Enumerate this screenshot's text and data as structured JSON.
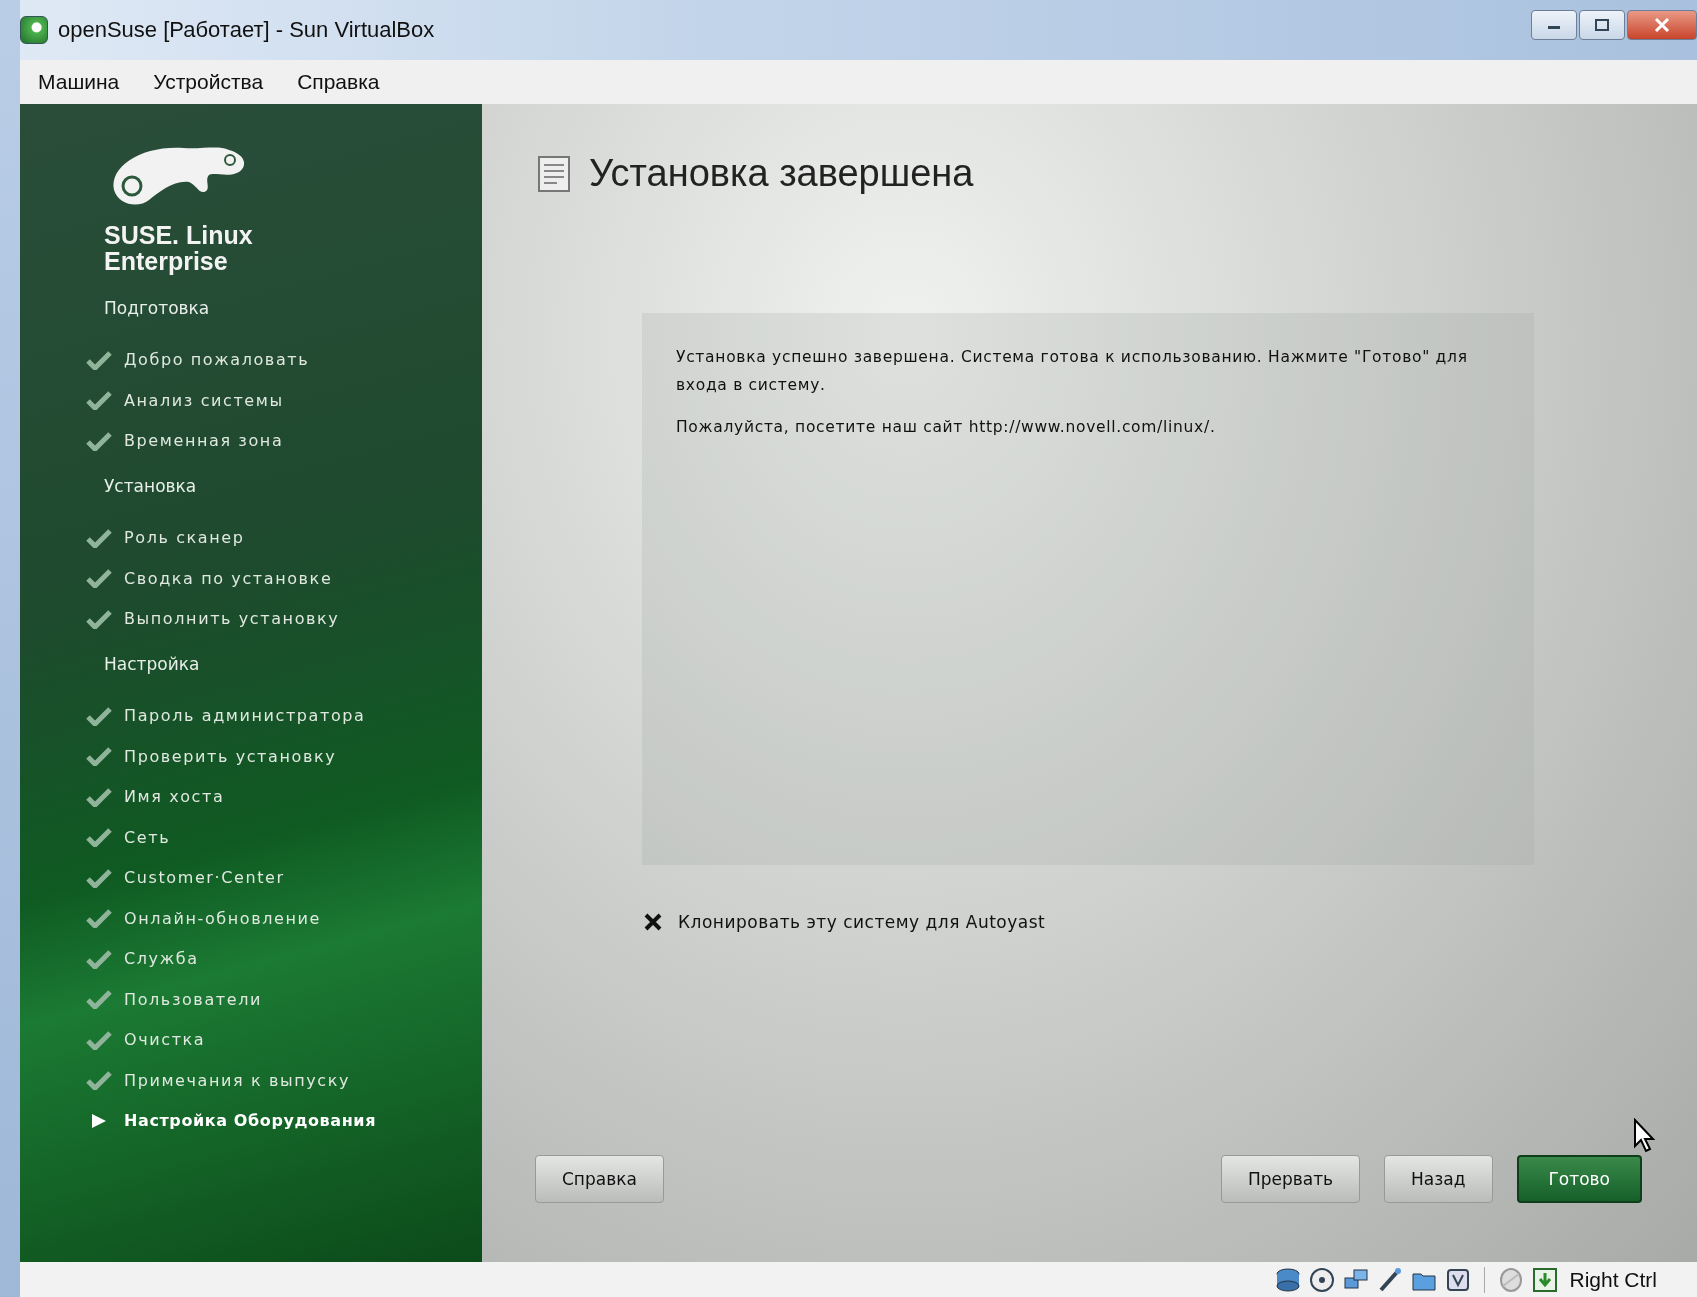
{
  "window": {
    "title": "openSuse [Работает] - Sun VirtualBox"
  },
  "menu": [
    "Машина",
    "Устройства",
    "Справка"
  ],
  "sidebar": {
    "brand": [
      "SUSE. Linux",
      "Enterprise"
    ],
    "sections": [
      {
        "heading": "Подготовка",
        "items": [
          {
            "label": "Добро пожаловать",
            "current": false
          },
          {
            "label": "Анализ системы",
            "current": false
          },
          {
            "label": "Временная зона",
            "current": false
          }
        ]
      },
      {
        "heading": "Установка",
        "items": [
          {
            "label": "Роль сканер",
            "current": false
          },
          {
            "label": "Сводка по установке",
            "current": false
          },
          {
            "label": "Выполнить установку",
            "current": false
          }
        ]
      },
      {
        "heading": "Настройка",
        "items": [
          {
            "label": "Пароль администратора",
            "current": false
          },
          {
            "label": "Проверить установку",
            "current": false
          },
          {
            "label": "Имя хоста",
            "current": false
          },
          {
            "label": "Сеть",
            "current": false
          },
          {
            "label": "Customer·Center",
            "current": false
          },
          {
            "label": "Онлайн-обновление",
            "current": false
          },
          {
            "label": "Служба",
            "current": false
          },
          {
            "label": "Пользователи",
            "current": false
          },
          {
            "label": "Очистка",
            "current": false
          },
          {
            "label": "Примечания к выпуску",
            "current": false
          },
          {
            "label": "Настройка Оборудования",
            "current": true
          }
        ]
      }
    ]
  },
  "main": {
    "title": "Установка завершена",
    "message": [
      "Установка успешно завершена. Система готова к использованию. Нажмите \"Готово\" для входа в систему.",
      "Пожалуйста, посетите наш сайт http://www.novell.com/linux/."
    ],
    "clone_checkbox": {
      "label": "Клонировать эту систему для Autoyast",
      "checked": true
    },
    "buttons": [
      {
        "label": "Справка",
        "default": false
      },
      {
        "label": "Прервать",
        "default": false
      },
      {
        "label": "Назад",
        "default": false
      },
      {
        "label": "Готово",
        "default": true
      }
    ]
  },
  "status_bar": {
    "host_key": "Right Ctrl"
  }
}
